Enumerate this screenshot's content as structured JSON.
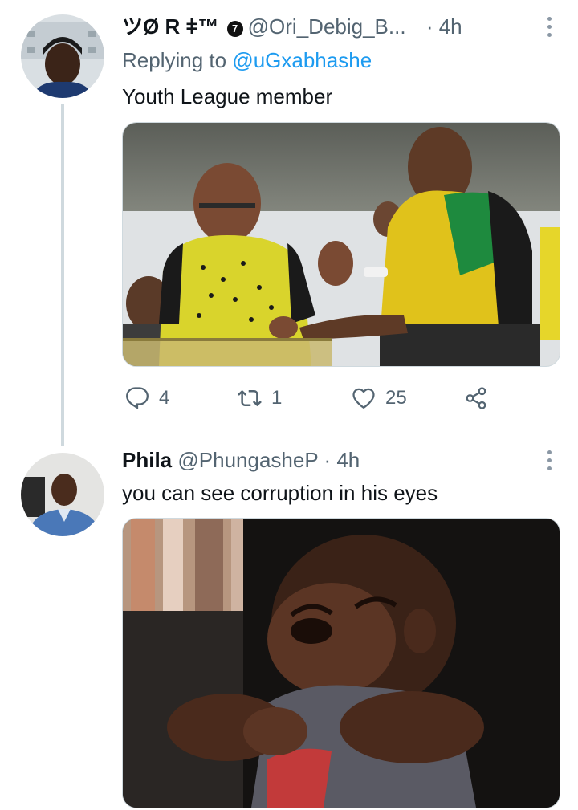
{
  "tweet1": {
    "display_name": "ツØ R ǂ™",
    "verified_glyph": "7",
    "handle": "@Ori_Debig_B...",
    "separator": "·",
    "time": "4h",
    "replying_prefix": "Replying to",
    "replying_to": "@uGxabhashe",
    "text": "Youth League member",
    "stats": {
      "replies": "4",
      "retweets": "1",
      "likes": "25"
    }
  },
  "tweet2": {
    "display_name": "Phila",
    "handle": "@PhungasheP",
    "separator": "·",
    "time": "4h",
    "text": "you can see corruption in his eyes"
  },
  "colors": {
    "accent": "#1d9bf0",
    "muted": "#536471",
    "line": "#cfd9de"
  },
  "icons": [
    "kebab-menu-icon",
    "reply-icon",
    "retweet-icon",
    "like-icon",
    "share-icon"
  ]
}
